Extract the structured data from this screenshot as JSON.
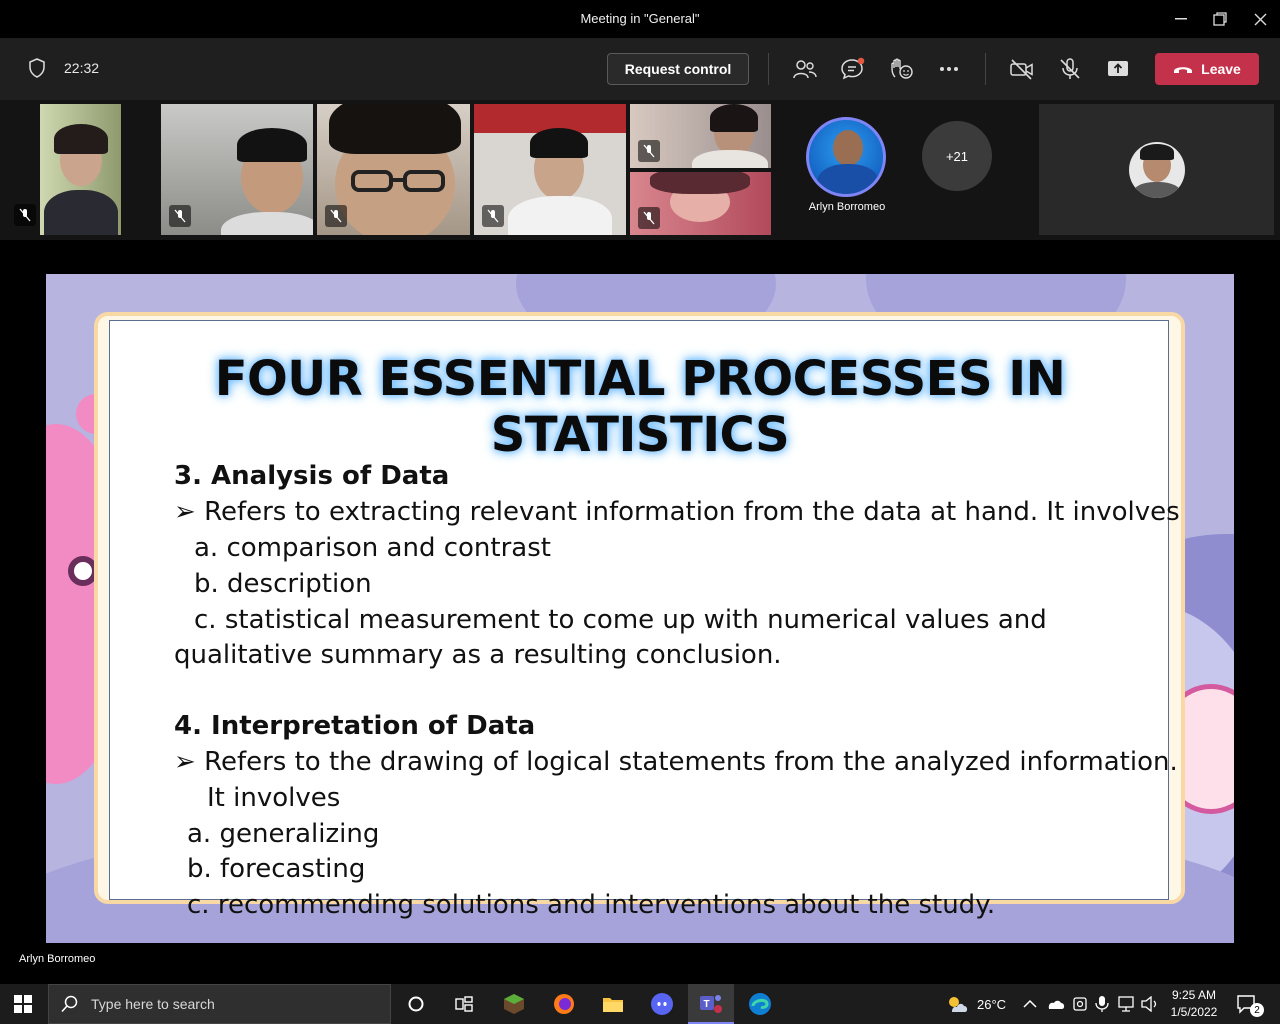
{
  "window": {
    "title": "Meeting in \"General\""
  },
  "toolbar": {
    "time": "22:32",
    "request_control": "Request control",
    "leave": "Leave",
    "leave_color": "#c4314b"
  },
  "participants": {
    "named": "Arlyn Borromeo",
    "overflow": "+21"
  },
  "slide": {
    "title": "FOUR ESSENTIAL PROCESSES IN STATISTICS",
    "s3_heading": "3. Analysis of Data",
    "s3_bullet": "Refers to extracting relevant information from the data at hand. It involves",
    "s3_a": "a. comparison and contrast",
    "s3_b": "b. description",
    "s3_c1": "c. statistical measurement to come up with numerical values and",
    "s3_c2": "qualitative summary as a resulting conclusion.",
    "s4_heading": "4. Interpretation of Data",
    "s4_bullet1": "Refers to the drawing of logical statements from the analyzed information.",
    "s4_bullet2": "It involves",
    "s4_a": "a. generalizing",
    "s4_b": "b. forecasting",
    "s4_c": "c. recommending solutions and interventions about the study.",
    "bullet_glyph": "➢"
  },
  "stage": {
    "presenter": "Arlyn Borromeo"
  },
  "taskbar": {
    "search_placeholder": "Type here to search",
    "temperature": "26°C",
    "time": "9:25 AM",
    "date": "1/5/2022",
    "notifications": "2"
  }
}
